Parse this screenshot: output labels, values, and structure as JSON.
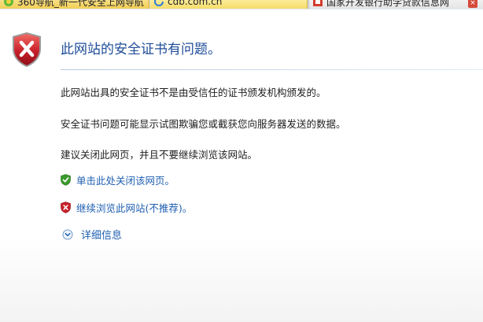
{
  "tabs": [
    {
      "label": "360导航_新一代安全上网导航",
      "icon": "360-icon"
    },
    {
      "label": "cdb.com.cn",
      "icon": "page-loading-icon"
    },
    {
      "label": "国家开发银行助学贷款信息网",
      "icon": "certificate-error-icon"
    }
  ],
  "error": {
    "title": "此网站的安全证书有问题。",
    "paragraphs": [
      "此网站出具的安全证书不是由受信任的证书颁发机构颁发的。",
      "安全证书问题可能显示试图欺骗您或截获您向服务器发送的数据。",
      "建议关闭此网页，并且不要继续浏览该网站。"
    ],
    "close_link": "单击此处关闭该网页。",
    "continue_link": "继续浏览此网站(不推荐)。",
    "more_info": "详细信息"
  },
  "colors": {
    "title": "#1f4d99",
    "link": "#1f5fb2",
    "shield_red": "#c8202a",
    "shield_green": "#3a9a2c"
  }
}
